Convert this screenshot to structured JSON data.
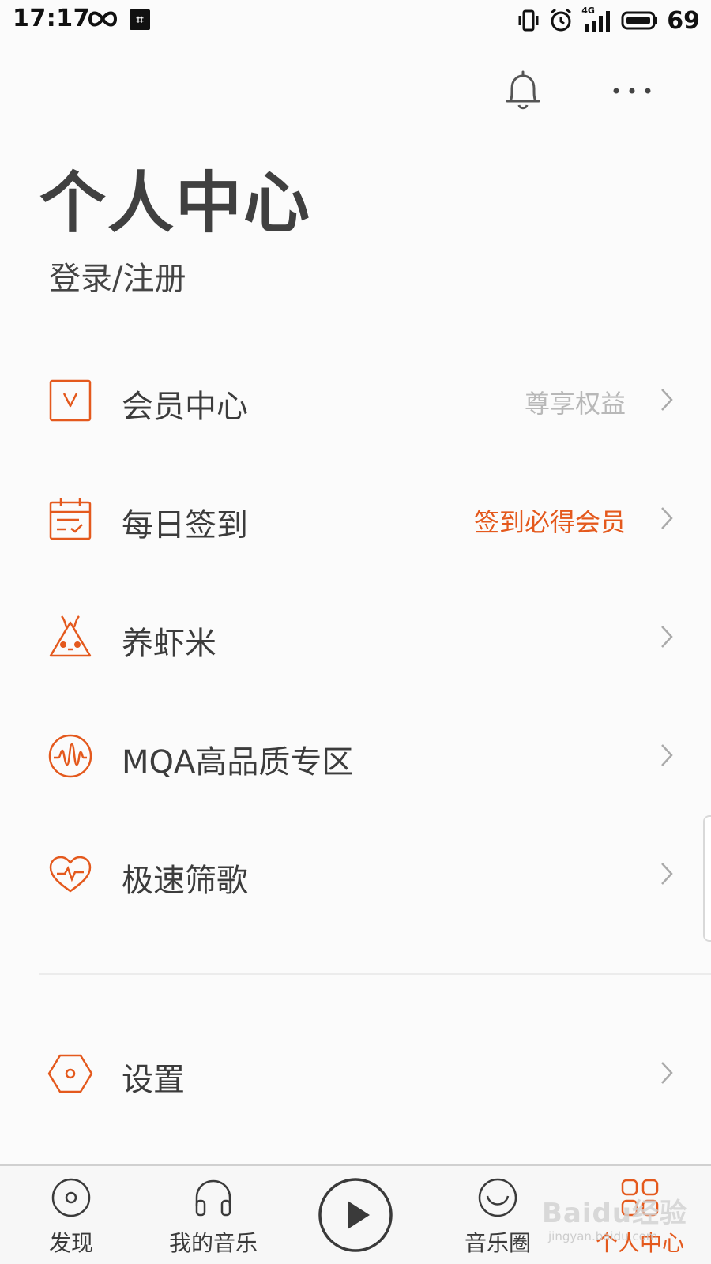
{
  "status_bar": {
    "time": "17:17",
    "network": "4G",
    "battery": "69",
    "hash_icon_glyph": "⌗"
  },
  "header": {
    "title": "个人中心",
    "login_label": "登录/注册"
  },
  "accent_color": "#e4591d",
  "menu": [
    {
      "label": "会员中心",
      "hint": "尊享权益",
      "hint_accent": false,
      "icon": "vip-icon"
    },
    {
      "label": "每日签到",
      "hint": "签到必得会员",
      "hint_accent": true,
      "icon": "calendar-check-icon"
    },
    {
      "label": "养虾米",
      "hint": "",
      "hint_accent": false,
      "icon": "shrimp-pet-icon"
    },
    {
      "label": "MQA高品质专区",
      "hint": "",
      "hint_accent": false,
      "icon": "waveform-icon"
    },
    {
      "label": "极速筛歌",
      "hint": "",
      "hint_accent": false,
      "icon": "heart-pulse-icon"
    }
  ],
  "settings": {
    "label": "设置",
    "icon": "settings-hexagon-icon"
  },
  "bottom_nav": [
    {
      "label": "发现",
      "icon": "disc-icon",
      "active": false
    },
    {
      "label": "我的音乐",
      "icon": "headphones-icon",
      "active": false
    },
    {
      "label": "音乐圈",
      "icon": "smile-circle-icon",
      "active": false
    },
    {
      "label": "个人中心",
      "icon": "grid-icon",
      "active": true
    }
  ],
  "watermark": {
    "text": "Baidu经验",
    "sub": "jingyan.baidu.com"
  }
}
